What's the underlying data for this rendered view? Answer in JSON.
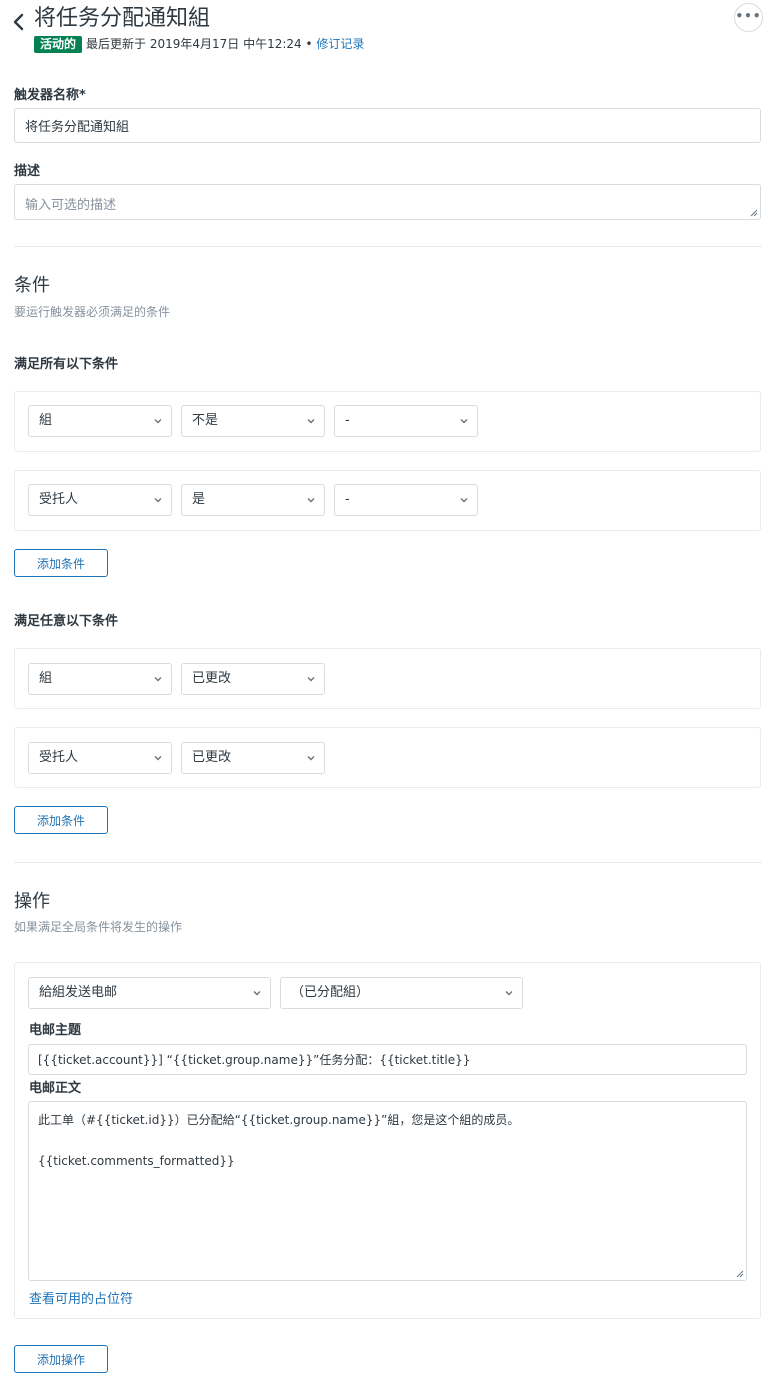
{
  "header": {
    "title": "将任务分配通知組",
    "status": "活动的",
    "updated": "最后更新于 2019年4月17日 中午12:24",
    "separator": "•",
    "revisions_link": "修订记录",
    "more_label": "•••"
  },
  "form": {
    "name_label": "触发器名称*",
    "name_value": "将任务分配通知組",
    "desc_label": "描述",
    "desc_placeholder": "输入可选的描述"
  },
  "conditions": {
    "title": "条件",
    "subtitle": "要运行触发器必须满足的条件",
    "all": {
      "heading": "满足所有以下条件",
      "rows": [
        {
          "field": "組",
          "operator": "不是",
          "value": "-"
        },
        {
          "field": "受托人",
          "operator": "是",
          "value": "-"
        }
      ],
      "add_button": "添加条件"
    },
    "any": {
      "heading": "满足任意以下条件",
      "rows": [
        {
          "field": "組",
          "operator": "已更改"
        },
        {
          "field": "受托人",
          "operator": "已更改"
        }
      ],
      "add_button": "添加条件"
    }
  },
  "actions": {
    "title": "操作",
    "subtitle": "如果满足全局条件将发生的操作",
    "action_type": "給組发送电邮",
    "target": "（已分配組）",
    "subject_label": "电邮主题",
    "subject_value": "[{{ticket.account}}] “{{ticket.group.name}}”任务分配：{{ticket.title}}",
    "body_label": "电邮正文",
    "body_line1": "此工单（#{{ticket.id}}）已分配給“{{ticket.group.name}}”組，您是这个組的成员。",
    "body_line2": "{{ticket.comments_formatted}}",
    "placeholders_link": "查看可用的占位符",
    "add_button": "添加操作"
  },
  "colors": {
    "accent": "#1f73b7",
    "status_green": "#038153",
    "border": "#d8dcde"
  }
}
